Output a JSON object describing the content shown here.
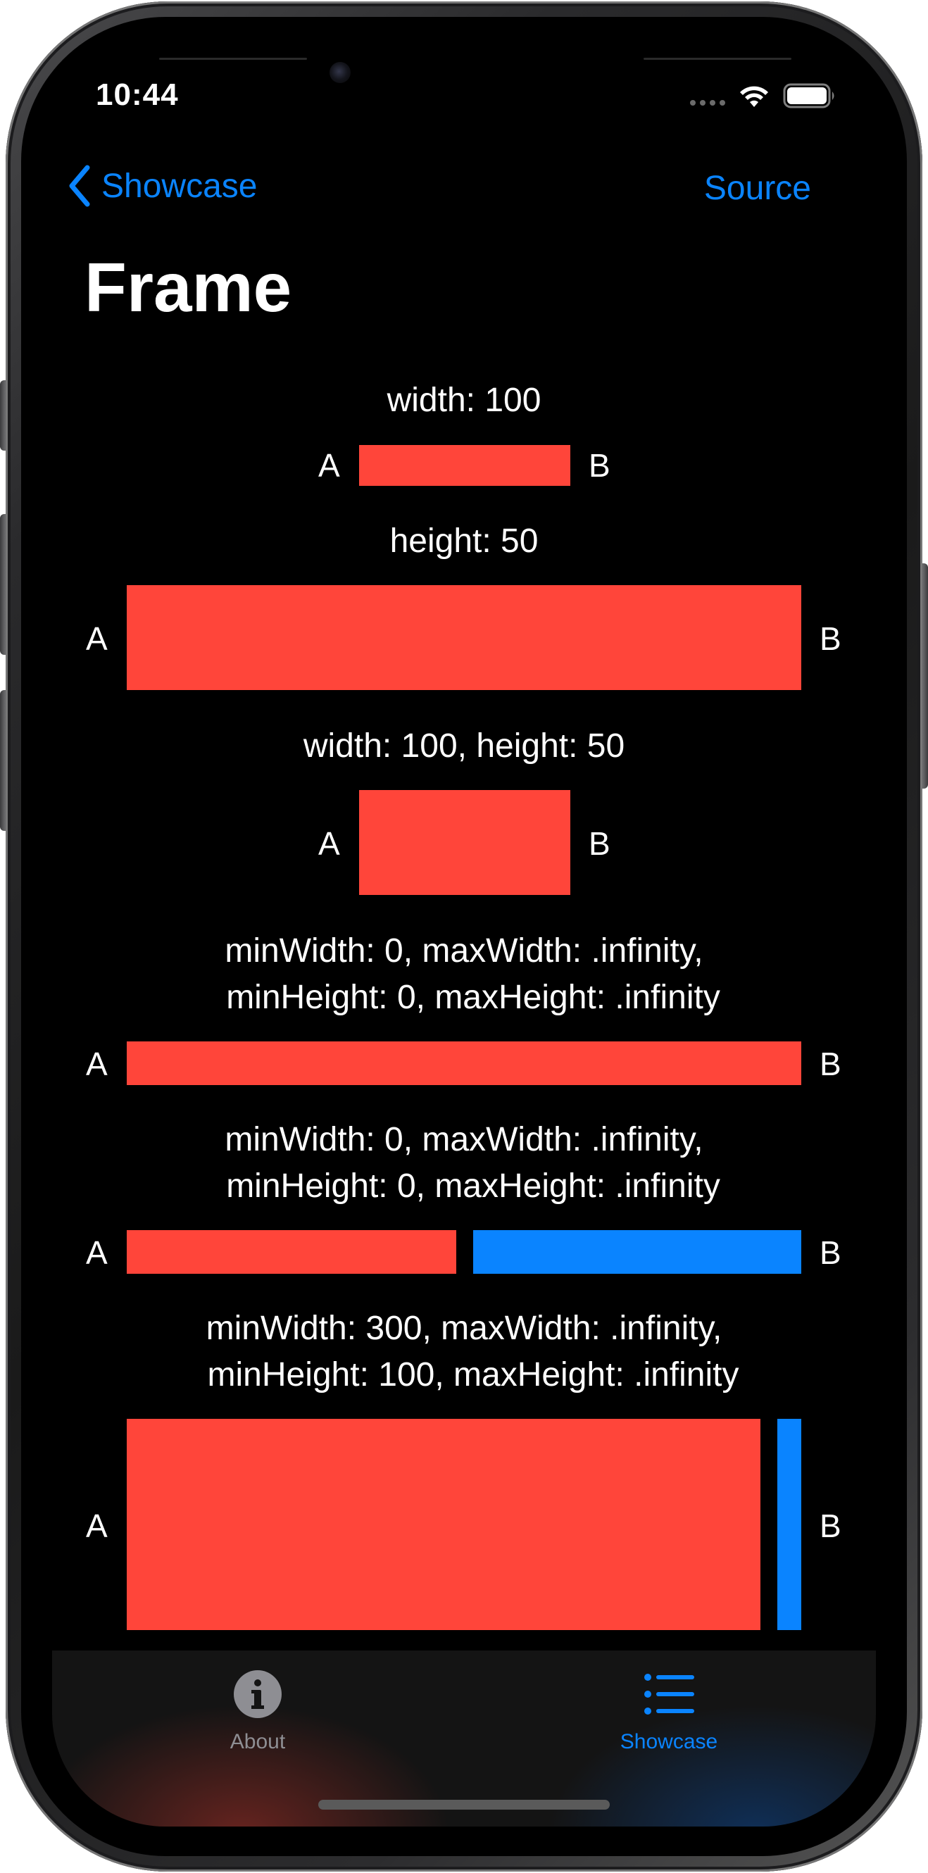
{
  "status_bar": {
    "time": "10:44"
  },
  "nav": {
    "back_label": "Showcase",
    "action_label": "Source"
  },
  "page": {
    "title": "Frame"
  },
  "demos": [
    {
      "label_lines": [
        "width: 100"
      ],
      "a": "A",
      "b": "B"
    },
    {
      "label_lines": [
        "height: 50"
      ],
      "a": "A",
      "b": "B"
    },
    {
      "label_lines": [
        "width: 100, height: 50"
      ],
      "a": "A",
      "b": "B"
    },
    {
      "label_lines": [
        "minWidth: 0, maxWidth: .infinity,",
        "minHeight: 0, maxHeight: .infinity"
      ],
      "a": "A",
      "b": "B"
    },
    {
      "label_lines": [
        "minWidth: 0, maxWidth: .infinity,",
        "minHeight: 0, maxHeight: .infinity"
      ],
      "a": "A",
      "b": "B"
    },
    {
      "label_lines": [
        "minWidth: 300, maxWidth: .infinity,",
        "minHeight: 100, maxHeight: .infinity"
      ],
      "a": "A",
      "b": "B"
    }
  ],
  "tab_bar": {
    "tabs": [
      {
        "label": "About",
        "icon": "info-icon",
        "selected": false
      },
      {
        "label": "Showcase",
        "icon": "list-icon",
        "selected": true
      }
    ]
  },
  "colors": {
    "accent": "#0a84ff",
    "red_box": "#ff453a",
    "blue_box": "#0a84ff",
    "background": "#000000",
    "tab_inactive": "#8e8e93"
  }
}
